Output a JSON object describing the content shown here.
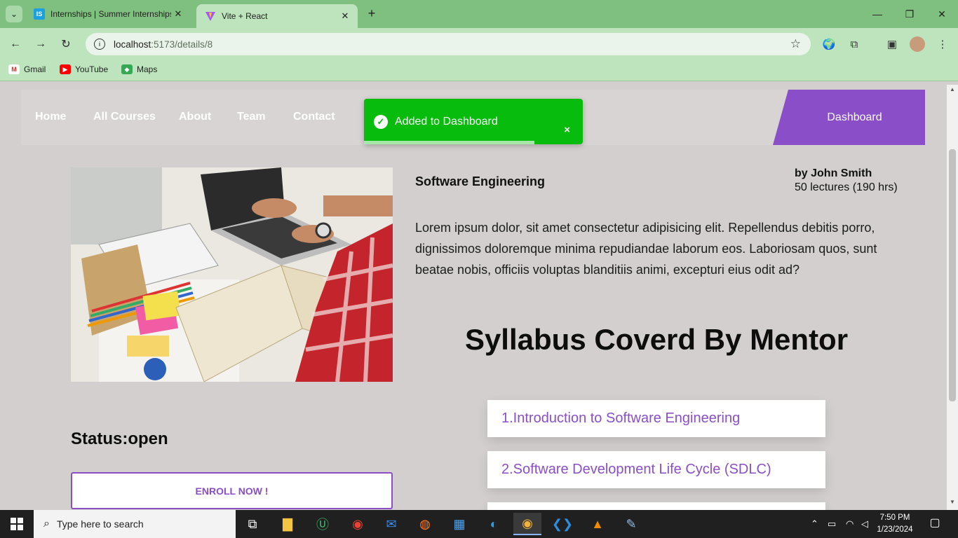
{
  "browser": {
    "tabs": [
      {
        "title": "Internships | Summer Internships",
        "favicon": "IS"
      },
      {
        "title": "Vite + React"
      }
    ],
    "url_host": "localhost",
    "url_path": ":5173/details/8",
    "bookmarks": [
      {
        "label": "Gmail"
      },
      {
        "label": "YouTube"
      },
      {
        "label": "Maps"
      }
    ]
  },
  "nav": {
    "links": [
      "Home",
      "All Courses",
      "About",
      "Team",
      "Contact"
    ],
    "dashboard_label": "Dashboard"
  },
  "toast": {
    "message": "Added to Dashboard",
    "close": "×",
    "progress": 0.78
  },
  "course": {
    "title": "Software Engineering",
    "author": "by John Smith",
    "lectures": "50 lectures (190 hrs)",
    "description": "Lorem ipsum dolor, sit amet consectetur adipisicing elit. Repellendus debitis porro, dignissimos doloremque minima repudiandae laborum eos. Laboriosam quos, sunt beatae nobis, officiis voluptas blanditiis animi, excepturi eius odit ad?",
    "status": "Status:open",
    "enroll_label": "ENROLL NOW !"
  },
  "syllabus": {
    "heading": "Syllabus Coverd By Mentor",
    "items": [
      "1.Introduction to Software Engineering",
      "2.Software Development Life Cycle (SDLC)"
    ]
  },
  "taskbar": {
    "search_placeholder": "Type here to search",
    "time": "7:50 PM",
    "date": "1/23/2024"
  },
  "colors": {
    "accent": "#8a4fc8",
    "toast": "#07bc0c",
    "page_bg": "#d3cfcf"
  }
}
